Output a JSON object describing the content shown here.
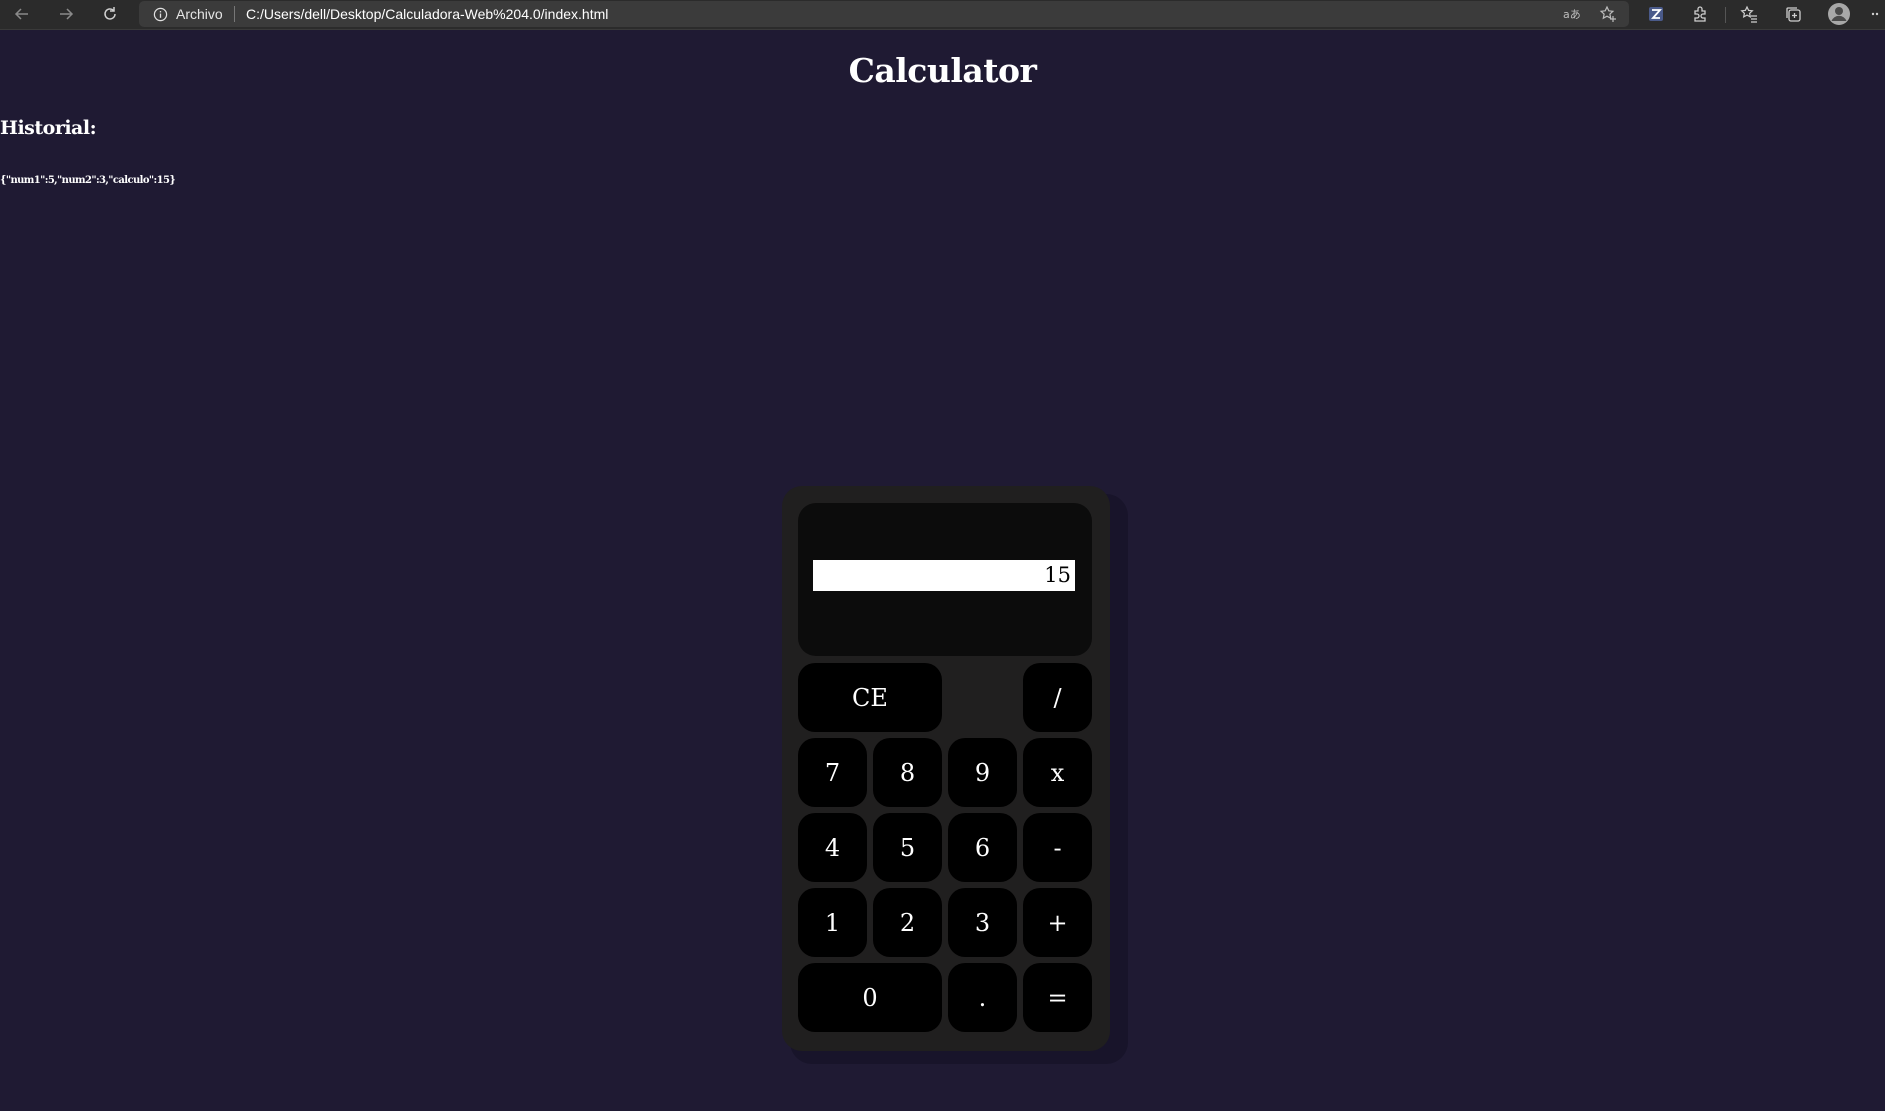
{
  "browser": {
    "address_label": "Archivo",
    "url": "C:/Users/dell/Desktop/Calculadora-Web%204.0/index.html",
    "icons": [
      "back-arrow-icon",
      "forward-arrow-icon",
      "refresh-icon",
      "info-icon",
      "read-aloud-icon",
      "favorite-add-icon",
      "zotero-extension-icon",
      "extensions-icon",
      "favorites-icon",
      "collections-icon",
      "profile-icon",
      "more-icon"
    ]
  },
  "page": {
    "title": "Calculator",
    "history_title": "Historial:",
    "history_entry": "{\"num1\":5,\"num2\":3,\"calculo\":15}"
  },
  "calculator": {
    "display_value": "15",
    "keys": {
      "ce": "CE",
      "divide": "/",
      "seven": "7",
      "eight": "8",
      "nine": "9",
      "multiply": "x",
      "four": "4",
      "five": "5",
      "six": "6",
      "minus": "-",
      "one": "1",
      "two": "2",
      "three": "3",
      "plus": "+",
      "zero": "0",
      "decimal": ".",
      "equals": "="
    }
  },
  "colors": {
    "page_background": "#1f1a33",
    "calculator_body": "#201f1f",
    "screen": "#0c0c0c",
    "key": "#000000",
    "text": "#ffffff"
  }
}
